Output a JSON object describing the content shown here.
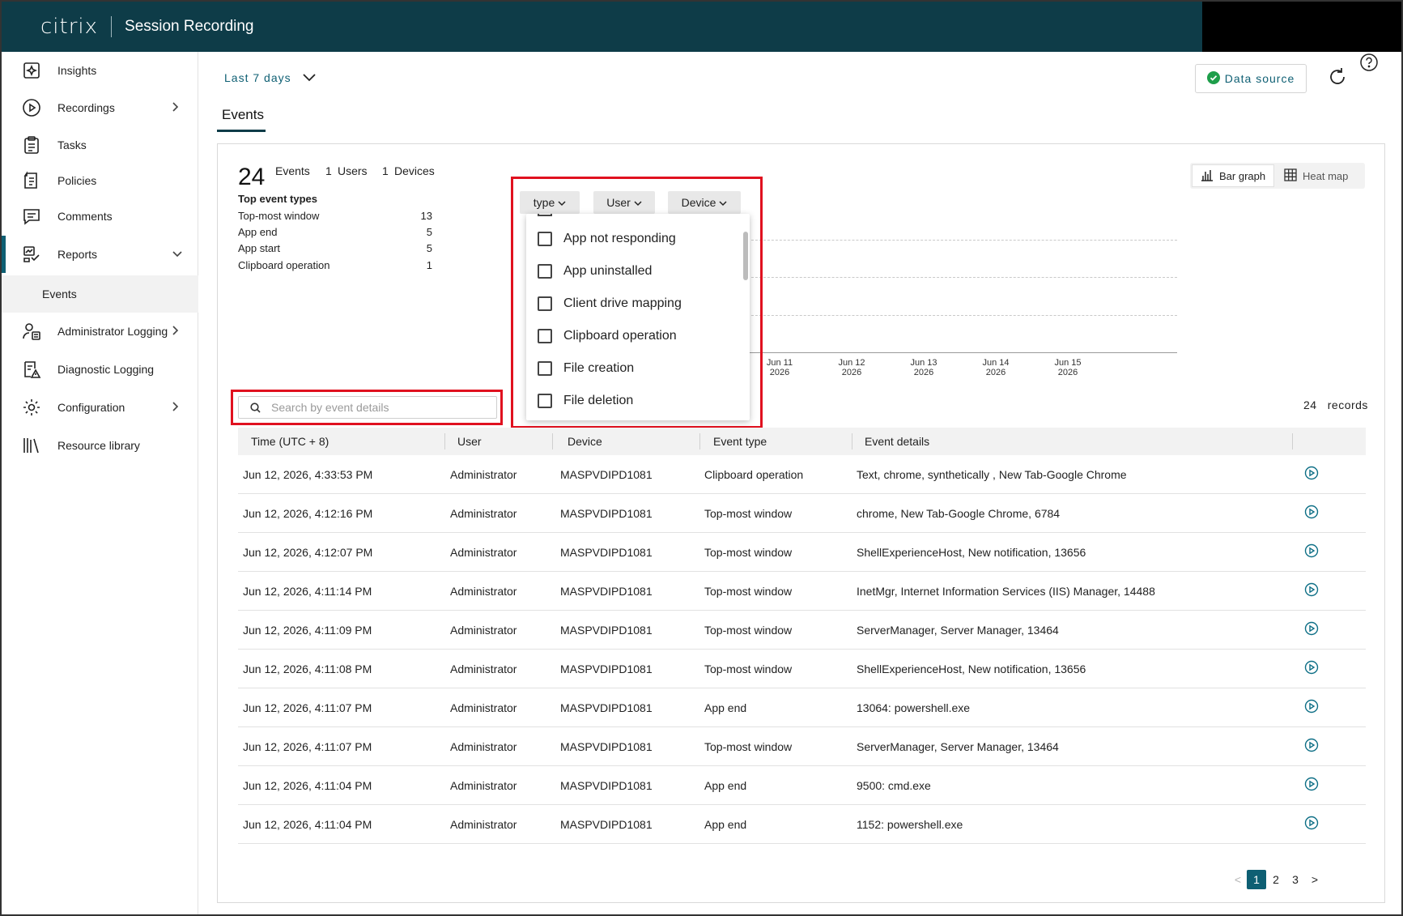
{
  "header": {
    "logo": "citrix",
    "app_title": "Session Recording"
  },
  "sidebar": {
    "items": [
      {
        "label": "Insights",
        "icon": "insights-icon"
      },
      {
        "label": "Recordings",
        "icon": "play-circle-icon"
      },
      {
        "label": "Tasks",
        "icon": "clipboard-icon"
      },
      {
        "label": "Policies",
        "icon": "policy-icon"
      },
      {
        "label": "Comments",
        "icon": "comment-icon"
      },
      {
        "label": "Reports",
        "icon": "reports-icon"
      },
      {
        "label": "Administrator Logging",
        "icon": "admin-user-icon"
      },
      {
        "label": "Diagnostic Logging",
        "icon": "diagnostic-icon"
      },
      {
        "label": "Configuration",
        "icon": "gear-icon"
      },
      {
        "label": "Resource library",
        "icon": "library-icon"
      }
    ],
    "sub_item": "Events"
  },
  "toolbar": {
    "range": "Last 7 days",
    "tab": "Events",
    "data_source": "Data source"
  },
  "summary": {
    "events_count": "24",
    "events_label": "Events",
    "users_count": "1",
    "users_label": "Users",
    "devices_count": "1",
    "devices_label": "Devices",
    "top_types_title": "Top event types",
    "top_types": [
      {
        "name": "Top-most window",
        "count": "13"
      },
      {
        "name": "App end",
        "count": "5"
      },
      {
        "name": "App start",
        "count": "5"
      },
      {
        "name": "Clipboard operation",
        "count": "1"
      }
    ]
  },
  "view_toggle": {
    "bar": "Bar graph",
    "heat": "Heat map"
  },
  "chart": {
    "x_ticks": [
      {
        "l1": "Jun 11",
        "l2": "2026"
      },
      {
        "l1": "Jun 12",
        "l2": "2026"
      },
      {
        "l1": "Jun 13",
        "l2": "2026"
      },
      {
        "l1": "Jun 14",
        "l2": "2026"
      },
      {
        "l1": "Jun 15",
        "l2": "2026"
      }
    ]
  },
  "filters": {
    "type_label": "type",
    "user_label": "User",
    "device_label": "Device",
    "options": [
      "App not responding",
      "App uninstalled",
      "Client drive mapping",
      "Clipboard operation",
      "File creation",
      "File deletion"
    ]
  },
  "search": {
    "placeholder": "Search by event details"
  },
  "records": {
    "count": "24",
    "label": "records"
  },
  "table": {
    "columns": [
      "Time (UTC + 8)",
      "User",
      "Device",
      "Event type",
      "Event details"
    ],
    "rows": [
      [
        "Jun 12, 2026, 4:33:53 PM",
        "Administrator",
        "MASPVDIPD1081",
        "Clipboard operation",
        "Text, chrome, synthetically , New Tab-Google Chrome"
      ],
      [
        "Jun 12, 2026, 4:12:16 PM",
        "Administrator",
        "MASPVDIPD1081",
        "Top-most window",
        "chrome, New Tab-Google Chrome, 6784"
      ],
      [
        "Jun 12, 2026, 4:12:07 PM",
        "Administrator",
        "MASPVDIPD1081",
        "Top-most window",
        "ShellExperienceHost, New notification, 13656"
      ],
      [
        "Jun 12, 2026, 4:11:14 PM",
        "Administrator",
        "MASPVDIPD1081",
        "Top-most window",
        "InetMgr, Internet Information Services (IIS) Manager, 14488"
      ],
      [
        "Jun 12, 2026, 4:11:09 PM",
        "Administrator",
        "MASPVDIPD1081",
        "Top-most window",
        "ServerManager, Server Manager, 13464"
      ],
      [
        "Jun 12, 2026, 4:11:08 PM",
        "Administrator",
        "MASPVDIPD1081",
        "Top-most window",
        "ShellExperienceHost, New notification, 13656"
      ],
      [
        "Jun 12, 2026, 4:11:07 PM",
        "Administrator",
        "MASPVDIPD1081",
        "App end",
        "13064: powershell.exe"
      ],
      [
        "Jun 12, 2026, 4:11:07 PM",
        "Administrator",
        "MASPVDIPD1081",
        "Top-most window",
        "ServerManager, Server Manager, 13464"
      ],
      [
        "Jun 12, 2026, 4:11:04 PM",
        "Administrator",
        "MASPVDIPD1081",
        "App end",
        "9500: cmd.exe"
      ],
      [
        "Jun 12, 2026, 4:11:04 PM",
        "Administrator",
        "MASPVDIPD1081",
        "App end",
        "1152: powershell.exe"
      ]
    ]
  },
  "pagination": {
    "pages": [
      "1",
      "2",
      "3"
    ],
    "current": "1",
    "prev": "<",
    "next": ">"
  },
  "colors": {
    "header_bg": "#0e3c48",
    "accent": "#0e5f73",
    "highlight": "#e0111f",
    "success": "#1e9e4a"
  }
}
